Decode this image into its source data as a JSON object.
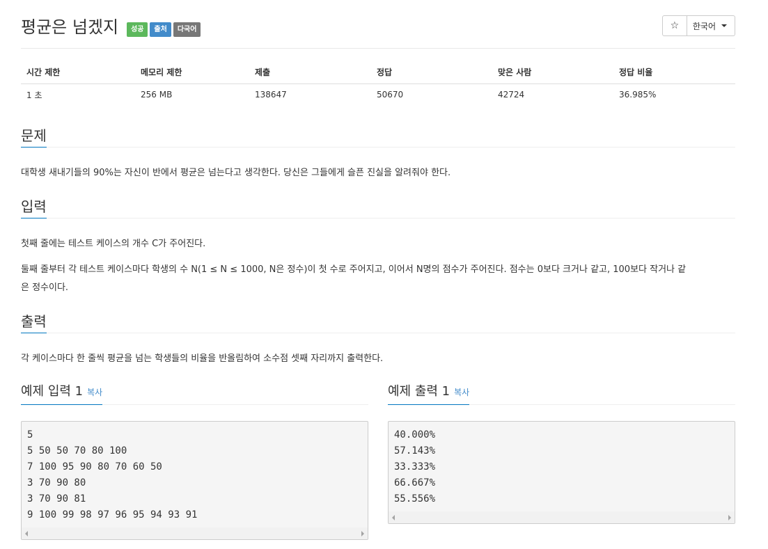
{
  "problem": {
    "title": "평균은 넘겠지",
    "badges": [
      "성공",
      "출처",
      "다국어"
    ],
    "star_label": "☆",
    "language_label": "한국어"
  },
  "info": {
    "headers": [
      "시간 제한",
      "메모리 제한",
      "제출",
      "정답",
      "맞은 사람",
      "정답 비율"
    ],
    "values": [
      "1 초",
      "256 MB",
      "138647",
      "50670",
      "42724",
      "36.985%"
    ]
  },
  "description": {
    "heading": "문제",
    "text": "대학생 새내기들의 90%는 자신이 반에서 평균은 넘는다고 생각한다. 당신은 그들에게 슬픈 진실을 알려줘야 한다."
  },
  "input": {
    "heading": "입력",
    "line1": "첫째 줄에는 테스트 케이스의 개수 C가 주어진다.",
    "line2": "둘째 줄부터 각 테스트 케이스마다 학생의 수 N(1 ≤ N ≤ 1000, N은 정수)이 첫 수로 주어지고, 이어서 N명의 점수가 주어진다. 점수는 0보다 크거나 같고, 100보다 작거나 같",
    "line3": "은 정수이다."
  },
  "output": {
    "heading": "출력",
    "text": "각 케이스마다 한 줄씩 평균을 넘는 학생들의 비율을 반올림하여 소수점 셋째 자리까지 출력한다."
  },
  "sample_input": {
    "heading": "예제 입력 1",
    "copy_label": "복사",
    "lines": "5\n5 50 50 70 80 100\n7 100 95 90 80 70 60 50\n3 70 90 80\n3 70 90 81\n9 100 99 98 97 96 95 94 93 91"
  },
  "sample_output": {
    "heading": "예제 출력 1",
    "copy_label": "복사",
    "lines": "40.000%\n57.143%\n33.333%\n66.667%\n55.556%"
  },
  "colors": {
    "accent": "#0076c0",
    "badge_success": "#5cb85c",
    "badge_source": "#428bca",
    "badge_multi": "#777777"
  }
}
